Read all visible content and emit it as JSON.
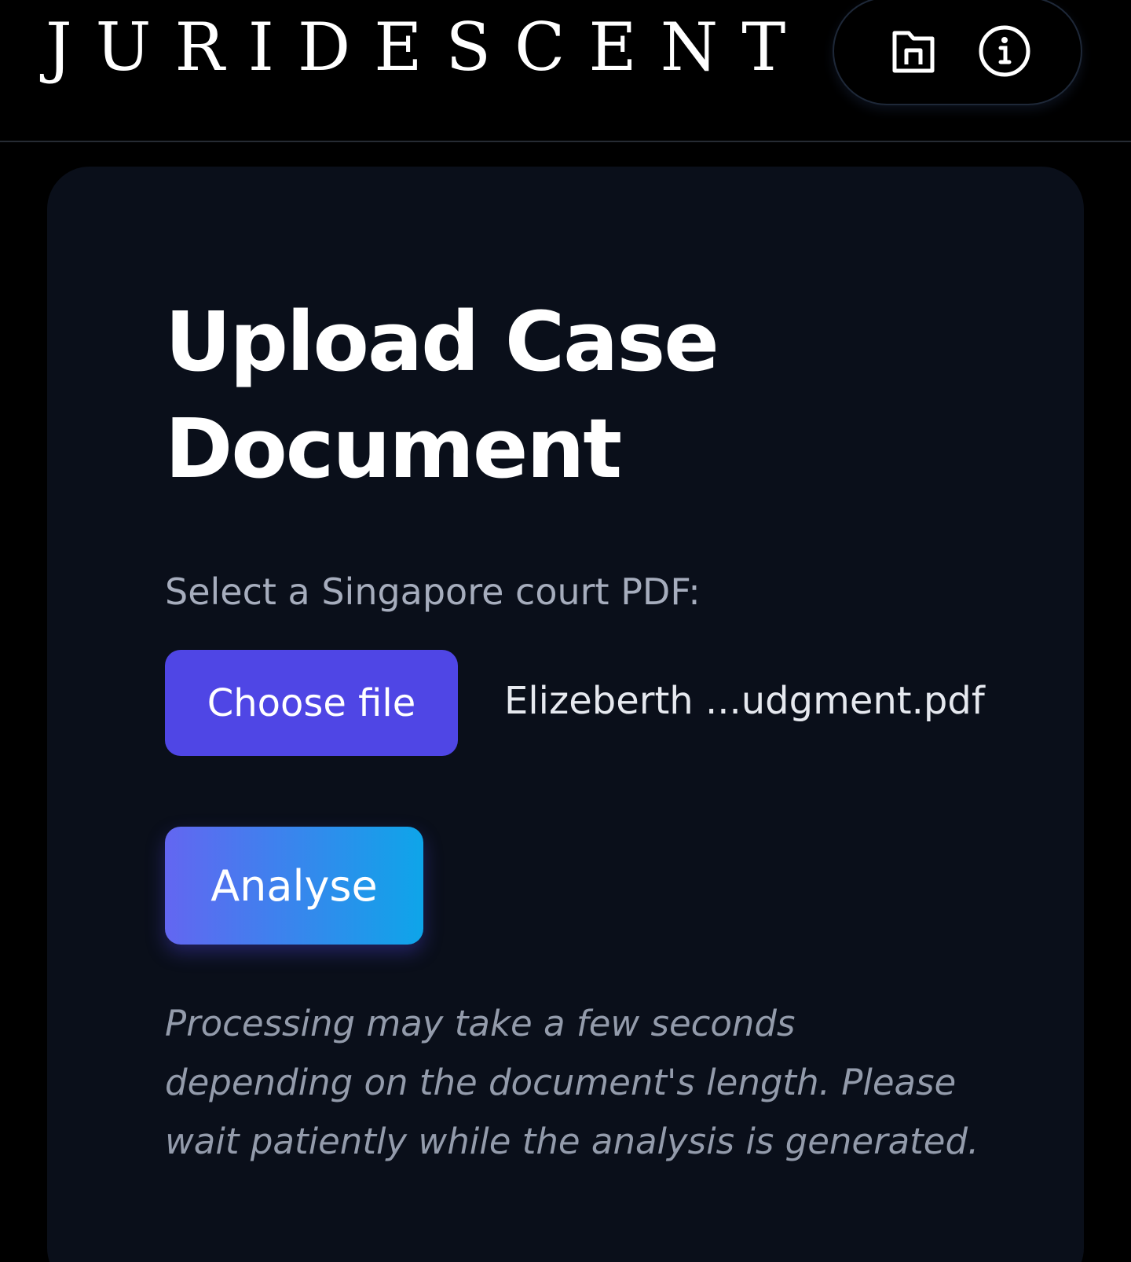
{
  "header": {
    "brand": "JURIDESCENT",
    "nav": [
      {
        "icon": "home-folder-icon",
        "label": ""
      },
      {
        "icon": "info-icon",
        "label": ""
      }
    ]
  },
  "upload": {
    "title": "Upload Case Document",
    "select_label": "Select a Singapore court PDF:",
    "choose_file_label": "Choose file",
    "selected_file": "Elizeberth ...udgment.pdf",
    "analyse_label": "Analyse",
    "processing_note": "Processing may take a few seconds depending on the document's length. Please wait patiently while the analysis is generated."
  },
  "colors": {
    "background": "#000000",
    "card": "#0a0f1a",
    "choose_button": "#4f46e5",
    "analyse_gradient_start": "#6366f1",
    "analyse_gradient_end": "#0ea5e9"
  }
}
